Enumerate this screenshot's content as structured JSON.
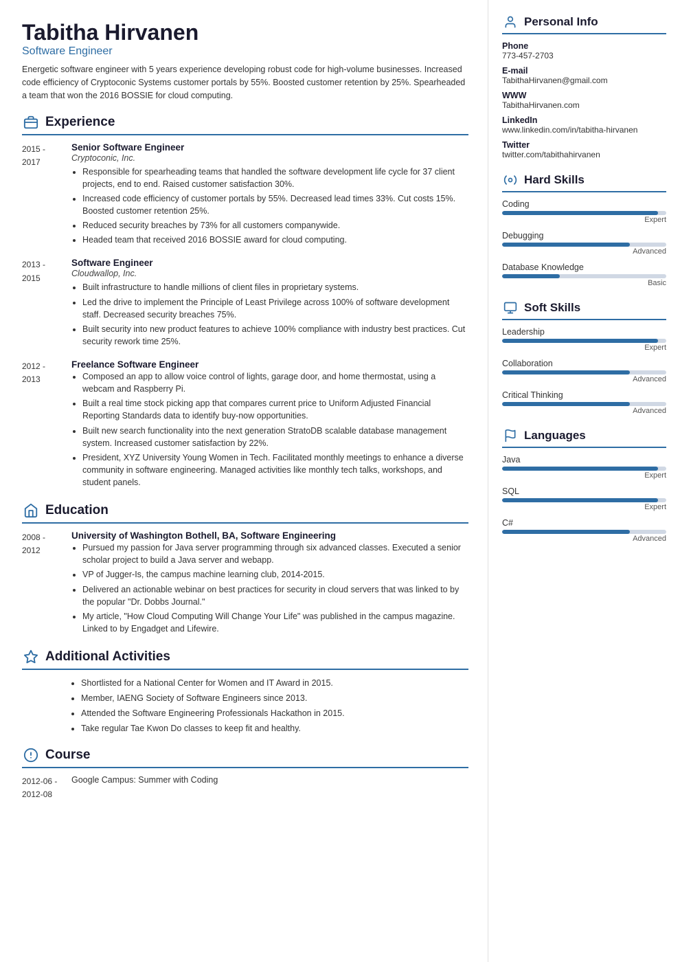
{
  "header": {
    "name": "Tabitha Hirvanen",
    "title": "Software Engineer",
    "summary": "Energetic software engineer with 5 years experience developing robust code for high-volume businesses. Increased code efficiency of Cryptoconic Systems customer portals by 55%. Boosted customer retention by 25%. Spearheaded a team that won the 2016 BOSSIE for cloud computing."
  },
  "sections": {
    "experience_label": "Experience",
    "education_label": "Education",
    "additional_label": "Additional Activities",
    "course_label": "Course"
  },
  "experience": [
    {
      "dates": "2015 -\n2017",
      "title": "Senior Software Engineer",
      "company": "Cryptoconic, Inc.",
      "bullets": [
        "Responsible for spearheading teams that handled the software development life cycle for 37 client projects, end to end. Raised customer satisfaction 30%.",
        "Increased code efficiency of customer portals by 55%. Decreased lead times 33%. Cut costs 15%. Boosted customer retention 25%.",
        "Reduced security breaches by 73% for all customers companywide.",
        "Headed team that received 2016 BOSSIE award for cloud computing."
      ]
    },
    {
      "dates": "2013 -\n2015",
      "title": "Software Engineer",
      "company": "Cloudwallop, Inc.",
      "bullets": [
        "Built infrastructure to handle millions of client files in proprietary systems.",
        "Led the drive to implement the Principle of Least Privilege across 100% of software development staff. Decreased security breaches 75%.",
        "Built security into new product features to achieve 100% compliance with industry best practices. Cut security rework time 25%."
      ]
    },
    {
      "dates": "2012 -\n2013",
      "title": "Freelance Software Engineer",
      "company": "",
      "bullets": [
        "Composed an app to allow voice control of lights, garage door, and home thermostat, using a webcam and Raspberry Pi.",
        "Built a real time stock picking app that compares current price to Uniform Adjusted Financial Reporting Standards data to identify buy-now opportunities.",
        "Built new search functionality into the next generation StratoDB scalable database management system. Increased customer satisfaction by 22%.",
        "President, XYZ University Young Women in Tech. Facilitated monthly meetings to enhance a diverse community in software engineering. Managed activities like monthly tech talks, workshops, and student panels."
      ]
    }
  ],
  "education": [
    {
      "dates": "2008 -\n2012",
      "title": "University of Washington Bothell, BA, Software Engineering",
      "company": "",
      "bullets": [
        "Pursued my passion for Java server programming through six advanced classes. Executed a senior scholar project to build a Java server and webapp.",
        "VP of Jugger-Is, the campus machine learning club, 2014-2015.",
        "Delivered an actionable webinar on best practices for security in cloud servers that was linked to by the popular \"Dr. Dobbs Journal.\"",
        "My article, \"How Cloud Computing Will Change Your Life\" was published in the campus magazine. Linked to by Engadget and Lifewire."
      ]
    }
  ],
  "additional": [
    "Shortlisted for a National Center for Women and IT Award in 2015.",
    "Member, IAENG Society of Software Engineers since 2013.",
    "Attended the Software Engineering Professionals Hackathon in 2015.",
    "Take regular Tae Kwon Do classes to keep fit and healthy."
  ],
  "courses": [
    {
      "dates": "2012-06 -\n2012-08",
      "name": "Google Campus: Summer with Coding"
    }
  ],
  "personal_info": {
    "label": "Personal Info",
    "items": [
      {
        "label": "Phone",
        "value": "773-457-2703"
      },
      {
        "label": "E-mail",
        "value": "TabithaHirvanen@gmail.com"
      },
      {
        "label": "WWW",
        "value": "TabithaHirvanen.com"
      },
      {
        "label": "LinkedIn",
        "value": "www.linkedin.com/in/tabitha-hirvanen"
      },
      {
        "label": "Twitter",
        "value": "twitter.com/tabithahirvanen"
      }
    ]
  },
  "hard_skills": {
    "label": "Hard Skills",
    "items": [
      {
        "name": "Coding",
        "level": "Expert",
        "pct": 95
      },
      {
        "name": "Debugging",
        "level": "Advanced",
        "pct": 78
      },
      {
        "name": "Database Knowledge",
        "level": "Basic",
        "pct": 35
      }
    ]
  },
  "soft_skills": {
    "label": "Soft Skills",
    "items": [
      {
        "name": "Leadership",
        "level": "Expert",
        "pct": 95
      },
      {
        "name": "Collaboration",
        "level": "Advanced",
        "pct": 78
      },
      {
        "name": "Critical Thinking",
        "level": "Advanced",
        "pct": 78
      }
    ]
  },
  "languages": {
    "label": "Languages",
    "items": [
      {
        "name": "Java",
        "level": "Expert",
        "pct": 95
      },
      {
        "name": "SQL",
        "level": "Expert",
        "pct": 95
      },
      {
        "name": "C#",
        "level": "Advanced",
        "pct": 78
      }
    ]
  },
  "icons": {
    "experience": "🏢",
    "education": "🏠",
    "additional": "⭐",
    "course": "💡",
    "personal_info": "👤",
    "hard_skills": "⚙️",
    "soft_skills": "🖥️",
    "languages": "🚩"
  }
}
